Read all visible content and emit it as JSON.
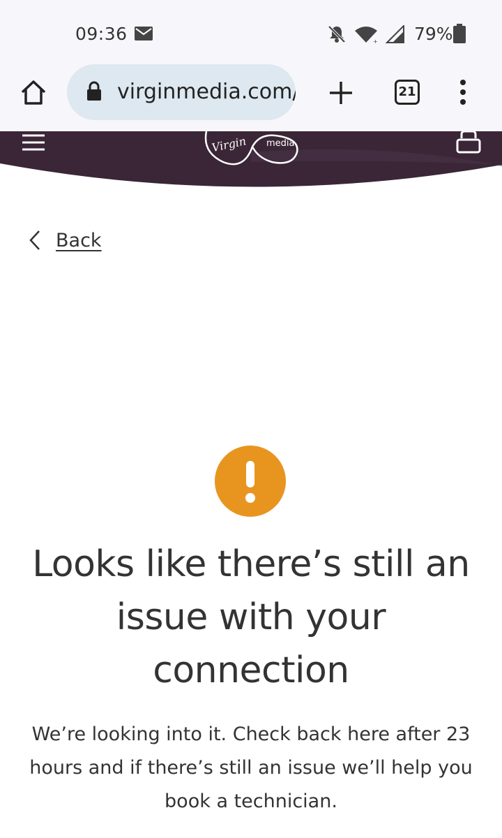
{
  "status_bar": {
    "time": "09:36",
    "battery": "79%",
    "icons": [
      "mail-icon",
      "bell-off-icon",
      "wifi-icon",
      "signal-icon",
      "battery-icon"
    ]
  },
  "browser": {
    "url": "virginmedia.com/",
    "tab_count": "21",
    "icons": [
      "home-icon",
      "lock-icon",
      "plus-icon",
      "more-icon"
    ]
  },
  "header": {
    "logo_text_virgin": "Virgin",
    "logo_text_media": "media",
    "brand_color": "#3a2637",
    "icons": [
      "menu-icon",
      "basket-icon"
    ]
  },
  "nav": {
    "back_label": "Back"
  },
  "message": {
    "headline": "Looks like there’s still an issue with your connection",
    "body": "We’re looking into it. Check back here after 23 hours and if there’s still an issue we’ll help you book a technician.",
    "warning_color": "#e8951f"
  }
}
